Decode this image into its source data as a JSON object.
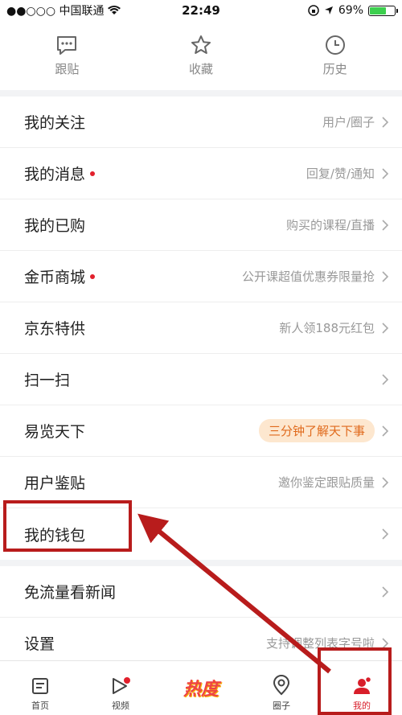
{
  "status": {
    "carrier": "●●○○○ 中国联通",
    "time": "22:49",
    "battery_text": "69%",
    "battery_level": 0.69
  },
  "topnav": [
    {
      "label": "跟贴",
      "icon": "comment-icon"
    },
    {
      "label": "收藏",
      "icon": "star-icon"
    },
    {
      "label": "历史",
      "icon": "clock-icon"
    }
  ],
  "rows": [
    {
      "title": "我的关注",
      "sub": "用户/圈子"
    },
    {
      "title": "我的消息",
      "sub": "回复/赞/通知",
      "dot": true
    },
    {
      "title": "我的已购",
      "sub": "购买的课程/直播"
    },
    {
      "title": "金币商城",
      "sub": "公开课超值优惠券限量抢",
      "dot": true
    },
    {
      "title": "京东特供",
      "sub": "新人领188元红包"
    },
    {
      "title": "扫一扫",
      "sub": ""
    },
    {
      "title": "易览天下",
      "badge": "三分钟了解天下事"
    },
    {
      "title": "用户鉴贴",
      "sub": "邀你鉴定跟贴质量"
    },
    {
      "title": "我的钱包",
      "sub": ""
    }
  ],
  "rows2": [
    {
      "title": "免流量看新闻",
      "sub": ""
    },
    {
      "title": "设置",
      "sub": "支持调整列表字号啦"
    }
  ],
  "tabs": [
    {
      "label": "首页",
      "icon": "home-icon"
    },
    {
      "label": "视频",
      "icon": "video-icon"
    },
    {
      "label": "热度",
      "icon": "hot-logo"
    },
    {
      "label": "圈子",
      "icon": "circle-icon"
    },
    {
      "label": "我的",
      "icon": "profile-icon",
      "active": true
    }
  ],
  "colors": {
    "accent": "#d81e2a",
    "annotation": "#b81c1c",
    "badge_bg": "#fde7cf",
    "badge_text": "#e06a1c"
  }
}
